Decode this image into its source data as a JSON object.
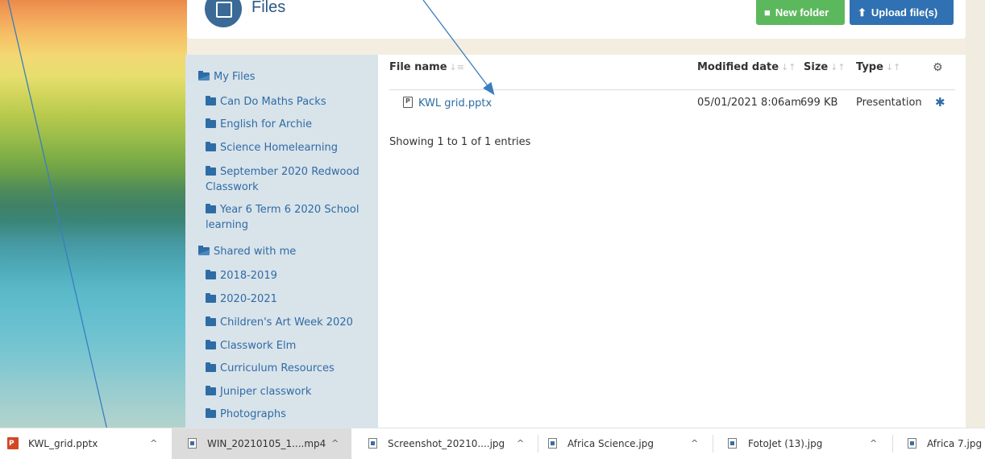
{
  "header": {
    "title": "Files",
    "new_folder_label": "New folder",
    "upload_label": "Upload file(s)"
  },
  "sidebar": {
    "my_files_label": "My Files",
    "my_files_items": [
      {
        "label": "Can Do Maths Packs"
      },
      {
        "label": "English for Archie"
      },
      {
        "label": "Science Homelearning"
      },
      {
        "label": "September 2020 Redwood Classwork"
      },
      {
        "label": "Year 6 Term 6 2020 School learning"
      }
    ],
    "shared_label": "Shared with me",
    "shared_items": [
      {
        "label": "2018-2019"
      },
      {
        "label": "2020-2021"
      },
      {
        "label": "Children's Art Week 2020"
      },
      {
        "label": "Classwork Elm"
      },
      {
        "label": "Curriculum Resources"
      },
      {
        "label": "Juniper classwork"
      },
      {
        "label": "Photographs"
      }
    ]
  },
  "table": {
    "columns": {
      "file_name": "File name",
      "modified_date": "Modified date",
      "size": "Size",
      "type": "Type"
    },
    "rows": [
      {
        "file_name": "KWL grid.pptx",
        "modified_date": "05/01/2021 8:06am",
        "size": "699 KB",
        "type": "Presentation"
      }
    ],
    "entries_text": "Showing 1 to 1 of 1 entries"
  },
  "downloads": [
    {
      "name": "KWL_grid.pptx",
      "icon": "powerpoint-icon"
    },
    {
      "name": "WIN_20210105_1....mp4",
      "icon": "video-file-icon"
    },
    {
      "name": "Screenshot_20210....jpg",
      "icon": "image-file-icon"
    },
    {
      "name": "Africa Science.jpg",
      "icon": "image-file-icon"
    },
    {
      "name": "FotoJet (13).jpg",
      "icon": "image-file-icon"
    },
    {
      "name": "Africa 7.jpg",
      "icon": "image-file-icon"
    }
  ],
  "colors": {
    "link_blue": "#2e6ca5",
    "sidebar_bg": "#d9e3ea",
    "green_button": "#5cb85c",
    "blue_button": "#2f71b2",
    "arrow": "#3a7ebf"
  }
}
